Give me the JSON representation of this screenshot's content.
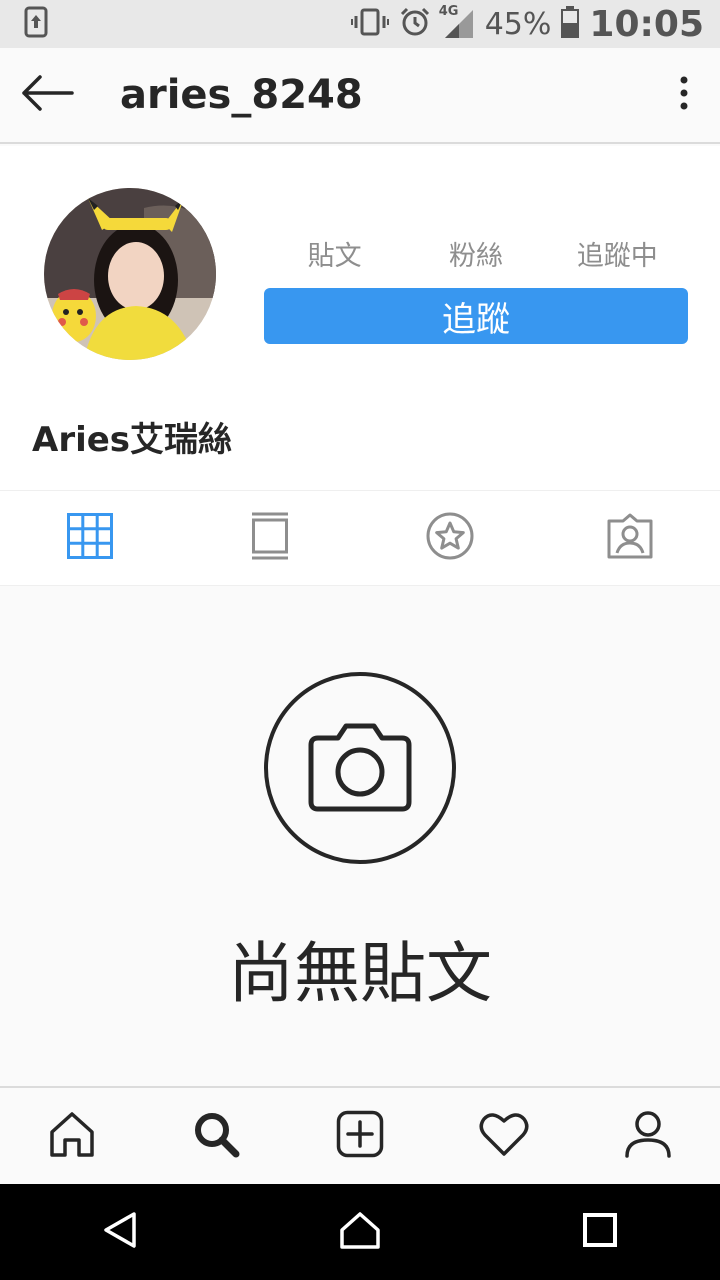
{
  "status_bar": {
    "network": "4G",
    "battery": "45%",
    "time": "10:05",
    "icons": [
      "screenshot-icon",
      "vibrate-icon",
      "alarm-icon",
      "signal-icon",
      "battery-icon"
    ]
  },
  "header": {
    "username": "aries_8248",
    "back_icon": "back-arrow-icon",
    "more_icon": "more-vertical-icon"
  },
  "profile": {
    "stats": [
      {
        "label": "貼文"
      },
      {
        "label": "粉絲"
      },
      {
        "label": "追蹤中"
      }
    ],
    "follow_label": "追蹤",
    "display_name": "Aries艾瑞絲"
  },
  "tabs": [
    {
      "icon": "grid-icon",
      "active": true
    },
    {
      "icon": "feed-icon",
      "active": false
    },
    {
      "icon": "star-icon",
      "active": false
    },
    {
      "icon": "tagged-icon",
      "active": false
    }
  ],
  "empty_state": {
    "icon": "camera-icon",
    "text": "尚無貼文"
  },
  "bottom_nav": [
    "home-icon",
    "search-icon",
    "add-post-icon",
    "heart-icon",
    "profile-icon"
  ],
  "system_nav": [
    "back-triangle-icon",
    "home-outline-icon",
    "recents-square-icon"
  ],
  "colors": {
    "accent": "#3897f0",
    "text": "#262626",
    "muted": "#8e8e8e"
  }
}
